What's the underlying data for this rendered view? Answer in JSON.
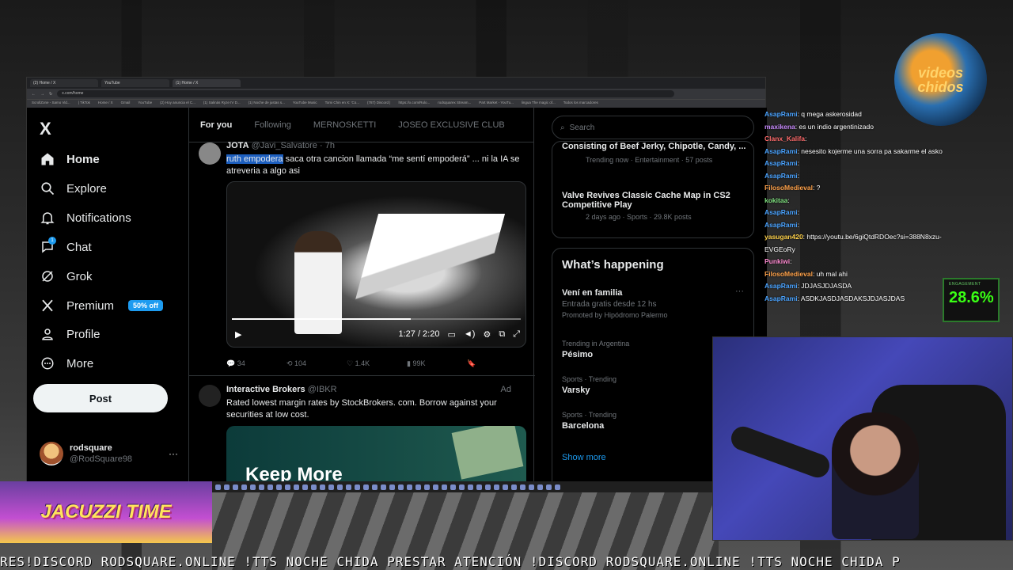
{
  "browser": {
    "tabs": [
      "(2) Home / X",
      "YouTube",
      "(1) Home / X"
    ],
    "url": "x.com/home",
    "bookmarks": [
      "ScrollZone - Samo Vid...",
      "| TikTok",
      "Home / X",
      "Gmail",
      "YouTube",
      "(2) Hoy anuncia el C...",
      "(1) Salinás Ryze IV D...",
      "(1) Noche de justas s...",
      "YouTube Music",
      "Tomi Chin en X: 'Co...",
      "(787) Discord |",
      "https://x.com/Rulo...",
      "rodsquarex Stream...",
      "Part Market - YouTu...",
      "lingua The magic of...",
      "Todos los marcadores"
    ]
  },
  "nav": {
    "logo": "X",
    "items": [
      {
        "label": "Home",
        "icon": "home-icon"
      },
      {
        "label": "Explore",
        "icon": "search-icon"
      },
      {
        "label": "Notifications",
        "icon": "bell-icon"
      },
      {
        "label": "Chat",
        "icon": "chat-icon"
      },
      {
        "label": "Grok",
        "icon": "grok-icon"
      },
      {
        "label": "Premium",
        "icon": "x-icon"
      },
      {
        "label": "Profile",
        "icon": "person-icon"
      },
      {
        "label": "More",
        "icon": "more-circle-icon"
      }
    ],
    "chat_badge": "1",
    "premium_pill": "50% off",
    "post_label": "Post",
    "account": {
      "name": "rodsquare",
      "handle": "@RodSquare98",
      "more": "···"
    }
  },
  "feed": {
    "tabs": [
      "For you",
      "Following",
      "MERNOSKETTI",
      "JOSEO EXCLUSIVE CLUB"
    ],
    "tweet1": {
      "name": "JOTA",
      "handle": "@Javi_Salvatore",
      "time": "7h",
      "highlight": "ruth empodera",
      "text": " saca otra cancion llamada “me sentí empoderá” ... ni la IA se atreveria a algo asi",
      "video_time": "1:27 / 2:20",
      "video_progress": 0.62,
      "replies": "34",
      "reposts": "104",
      "likes": "1.4K",
      "views": "99K"
    },
    "tweet2": {
      "name": "Interactive Brokers",
      "handle": "@IBKR",
      "ad": "Ad",
      "text": "Rated lowest margin rates by StockBrokers. com. Borrow against your securities at low cost.",
      "image_text": "Keep More"
    }
  },
  "right": {
    "search_placeholder": "Search",
    "top_trends": [
      {
        "title": "Consisting of Beef Jerky, Chipotle, Candy, ...",
        "meta": "Trending now · Entertainment · 57 posts"
      },
      {
        "title": "Valve Revives Classic Cache Map in CS2 Competitive Play",
        "meta": "2 days ago · Sports · 29.8K posts"
      }
    ],
    "happening_title": "What’s happening",
    "promo": {
      "title": "Vení en familia",
      "sub": "Entrada gratis desde 12 hs",
      "by": "Promoted by Hipódromo Palermo"
    },
    "trends": [
      {
        "meta": "Trending in Argentina",
        "title": "Pésimo"
      },
      {
        "meta": "Sports · Trending",
        "title": "Varsky"
      },
      {
        "meta": "Sports · Trending",
        "title": "Barcelona"
      }
    ],
    "show_more": "Show more"
  },
  "overlay": {
    "logo_text": "videos chidos",
    "chat": [
      {
        "name": "AsapRami",
        "msg": ": q mega askerosidad"
      },
      {
        "name": "maxikena",
        "msg": ": es un indio argentinizado"
      },
      {
        "name": "Clanx_Kalifa",
        "msg": ":"
      },
      {
        "name": "AsapRami",
        "msg": ": nesesito kojerme una sorra pa sakarme el asko"
      },
      {
        "name": "AsapRami",
        "msg": ":"
      },
      {
        "name": "AsapRami",
        "msg": ":"
      },
      {
        "name": "FilosoMedieval",
        "msg": ": ?"
      },
      {
        "name": "kokitaa",
        "msg": ":"
      },
      {
        "name": "AsapRami",
        "msg": ":"
      },
      {
        "name": "AsapRami",
        "msg": ":"
      },
      {
        "name": "yasugan420",
        "msg": ": https://youtu.be/6giQtdRDOec?si=388N8xzu-EVGEoRy"
      },
      {
        "name": "Punkiwi",
        "msg": ":"
      },
      {
        "name": "FilosoMedieval",
        "msg": ": uh mal ahi"
      },
      {
        "name": "AsapRami",
        "msg": ": JDJASJDJASDA"
      },
      {
        "name": "AsapRami",
        "msg": ": ASDKJASDJASDAKSJDJASJDAS"
      }
    ],
    "engagement_label": "ENGAGEMENT",
    "engagement_value": "28.6%",
    "jacuzzi": "JACUZZI TIME",
    "ticker": "RES!DISCORD RODSQUARE.ONLINE !TTS NOCHE CHIDA PRESTAR ATENCIÓN !DISCORD RODSQUARE.ONLINE !TTS NOCHE CHIDA P"
  }
}
